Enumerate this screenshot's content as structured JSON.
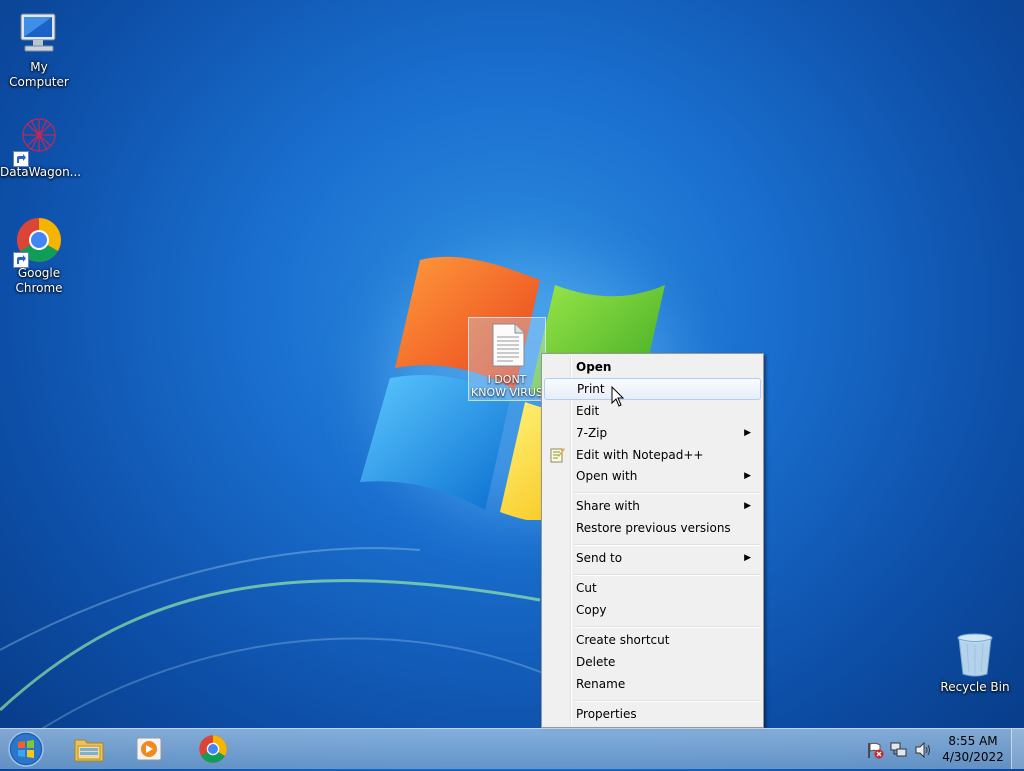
{
  "desktop": {
    "icons": [
      {
        "label": "My Computer"
      },
      {
        "label": "DataWagon..."
      },
      {
        "label": "Google Chrome"
      },
      {
        "label": "Recycle Bin"
      }
    ],
    "selected_file": {
      "label": "I DONT KNOW VIRUS"
    }
  },
  "context_menu": {
    "items": [
      {
        "label": "Open",
        "bold": true
      },
      {
        "label": "Print",
        "hover": true
      },
      {
        "label": "Edit"
      },
      {
        "label": "7-Zip",
        "submenu": true
      },
      {
        "label": "Edit with Notepad++",
        "icon": "notepad-plus-plus-icon"
      },
      {
        "label": "Open with",
        "submenu": true
      },
      {
        "label": "Share with",
        "submenu": true
      },
      {
        "label": "Restore previous versions"
      },
      {
        "label": "Send to",
        "submenu": true
      },
      {
        "label": "Cut"
      },
      {
        "label": "Copy"
      },
      {
        "label": "Create shortcut"
      },
      {
        "label": "Delete"
      },
      {
        "label": "Rename"
      },
      {
        "label": "Properties"
      }
    ],
    "submenu_arrow": "▶"
  },
  "taskbar": {
    "pinned": [
      {
        "name": "windows-explorer-icon"
      },
      {
        "name": "media-player-icon"
      },
      {
        "name": "google-chrome-icon"
      }
    ],
    "tray_icons": [
      "action-center-flag-icon",
      "network-icon",
      "volume-icon"
    ],
    "clock": {
      "time": "8:55 AM",
      "date": "4/30/2022"
    }
  }
}
